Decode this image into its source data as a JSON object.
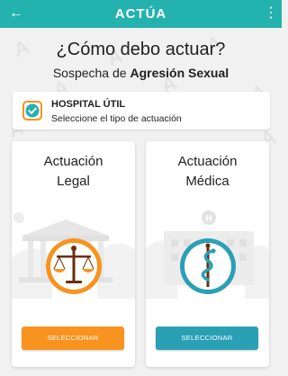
{
  "appbar": {
    "title": "ACTÚA",
    "back_glyph": "←",
    "menu_glyph": "⋮"
  },
  "main": {
    "heading": "¿Cómo debo actuar?",
    "subheading_prefix": "Sospecha de ",
    "subheading_bold": "Agresión Sexual"
  },
  "hospital": {
    "name": "HOSPITAL ÚTIL",
    "subtitle": "Seleccione el tipo de actuación"
  },
  "options": [
    {
      "title_line1": "Actuación",
      "title_line2": "Legal",
      "button_label": "SELECCIONAR",
      "emblem": "scales-of-justice-icon",
      "button_color": "#f7931e"
    },
    {
      "title_line1": "Actuación",
      "title_line2": "Médica",
      "button_label": "SELECCIONAR",
      "emblem": "caduceus-icon",
      "button_color": "#2aa0b5"
    }
  ],
  "colors": {
    "primary": "#23b2ad",
    "legal_accent": "#f7931e",
    "medical_accent": "#2aa0b5"
  }
}
